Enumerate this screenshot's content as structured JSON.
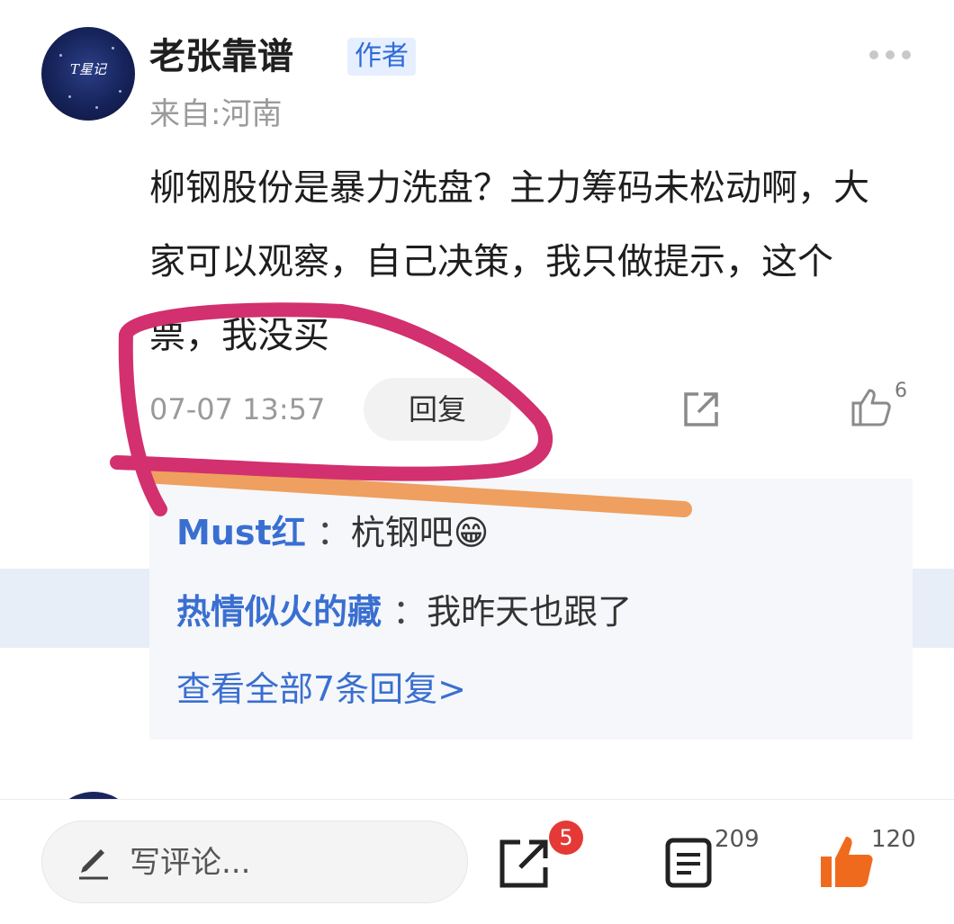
{
  "post": {
    "avatar_text": "T星记",
    "username": "老张靠谱",
    "author_tag": "作者",
    "location": "来自:河南",
    "content": "柳钢股份是暴力洗盘？主力筹码未松动啊，大家可以观察，自己决策，我只做提示，这个票，我没买",
    "timestamp": "07-07 13:57",
    "reply_label": "回复",
    "like_count": "6"
  },
  "replies": [
    {
      "name": "Must红",
      "sep": " ：",
      "text": "杭钢吧😁"
    },
    {
      "name": "热情似火的藏",
      "sep": " ：",
      "text": "我昨天也跟了"
    }
  ],
  "view_all": "查看全部7条回复>",
  "bottom_bar": {
    "comment_placeholder": "写评论...",
    "share_badge": "5",
    "comment_count": "209",
    "like_count": "120"
  },
  "colors": {
    "accent_blue": "#3a6fd1",
    "like_orange": "#f06a1e",
    "badge_red": "#e53935",
    "annotation_pink": "#d2306f",
    "annotation_orange": "#ee9a56"
  },
  "icons": [
    "more-icon",
    "share-icon",
    "thumbs-up-icon",
    "pencil-icon",
    "comments-list-icon",
    "thumbs-up-filled-icon"
  ]
}
